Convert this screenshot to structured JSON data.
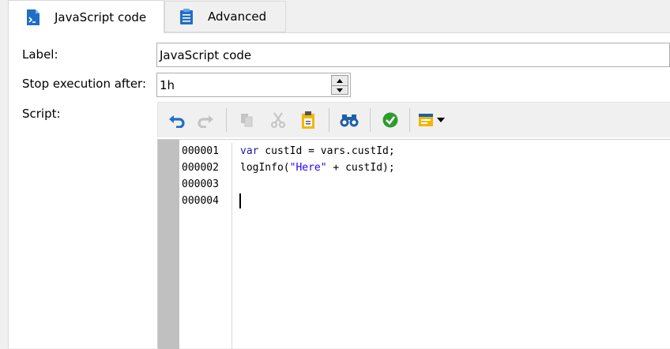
{
  "tabs": [
    {
      "label": "JavaScript code",
      "icon": "js-file-icon",
      "active": true
    },
    {
      "label": "Advanced",
      "icon": "clipboard-list-icon",
      "active": false
    }
  ],
  "form": {
    "label_label": "Label:",
    "label_value": "JavaScript code",
    "stop_label": "Stop execution after:",
    "stop_value": "1h",
    "script_label": "Script:"
  },
  "toolbar": [
    {
      "name": "undo-button",
      "icon": "undo-icon",
      "enabled": true
    },
    {
      "name": "redo-button",
      "icon": "redo-icon",
      "enabled": false
    },
    {
      "name": "copy-button",
      "icon": "copy-icon",
      "enabled": false
    },
    {
      "name": "cut-button",
      "icon": "cut-icon",
      "enabled": false
    },
    {
      "name": "paste-button",
      "icon": "paste-icon",
      "enabled": true
    },
    {
      "name": "find-button",
      "icon": "binoculars-icon",
      "enabled": true
    },
    {
      "name": "validate-button",
      "icon": "check-circle-icon",
      "enabled": true
    },
    {
      "name": "insert-menu-button",
      "icon": "insert-field-icon",
      "enabled": true
    }
  ],
  "editor": {
    "line_numbers": [
      "000001",
      "000002",
      "000003",
      "000004"
    ],
    "lines": [
      {
        "kw": "var",
        "rest": " custId = vars.custId;"
      },
      {
        "pre": "logInfo(",
        "str": "\"Here\"",
        "post": " + custId);"
      },
      {
        "text": ""
      },
      {
        "text": ""
      }
    ]
  },
  "colors": {
    "accent_blue": "#1f6fc5",
    "keyword": "#1a1aa6",
    "string": "#2a00ff",
    "check_green": "#2e9c2e",
    "paste_yellow": "#f2b705"
  }
}
